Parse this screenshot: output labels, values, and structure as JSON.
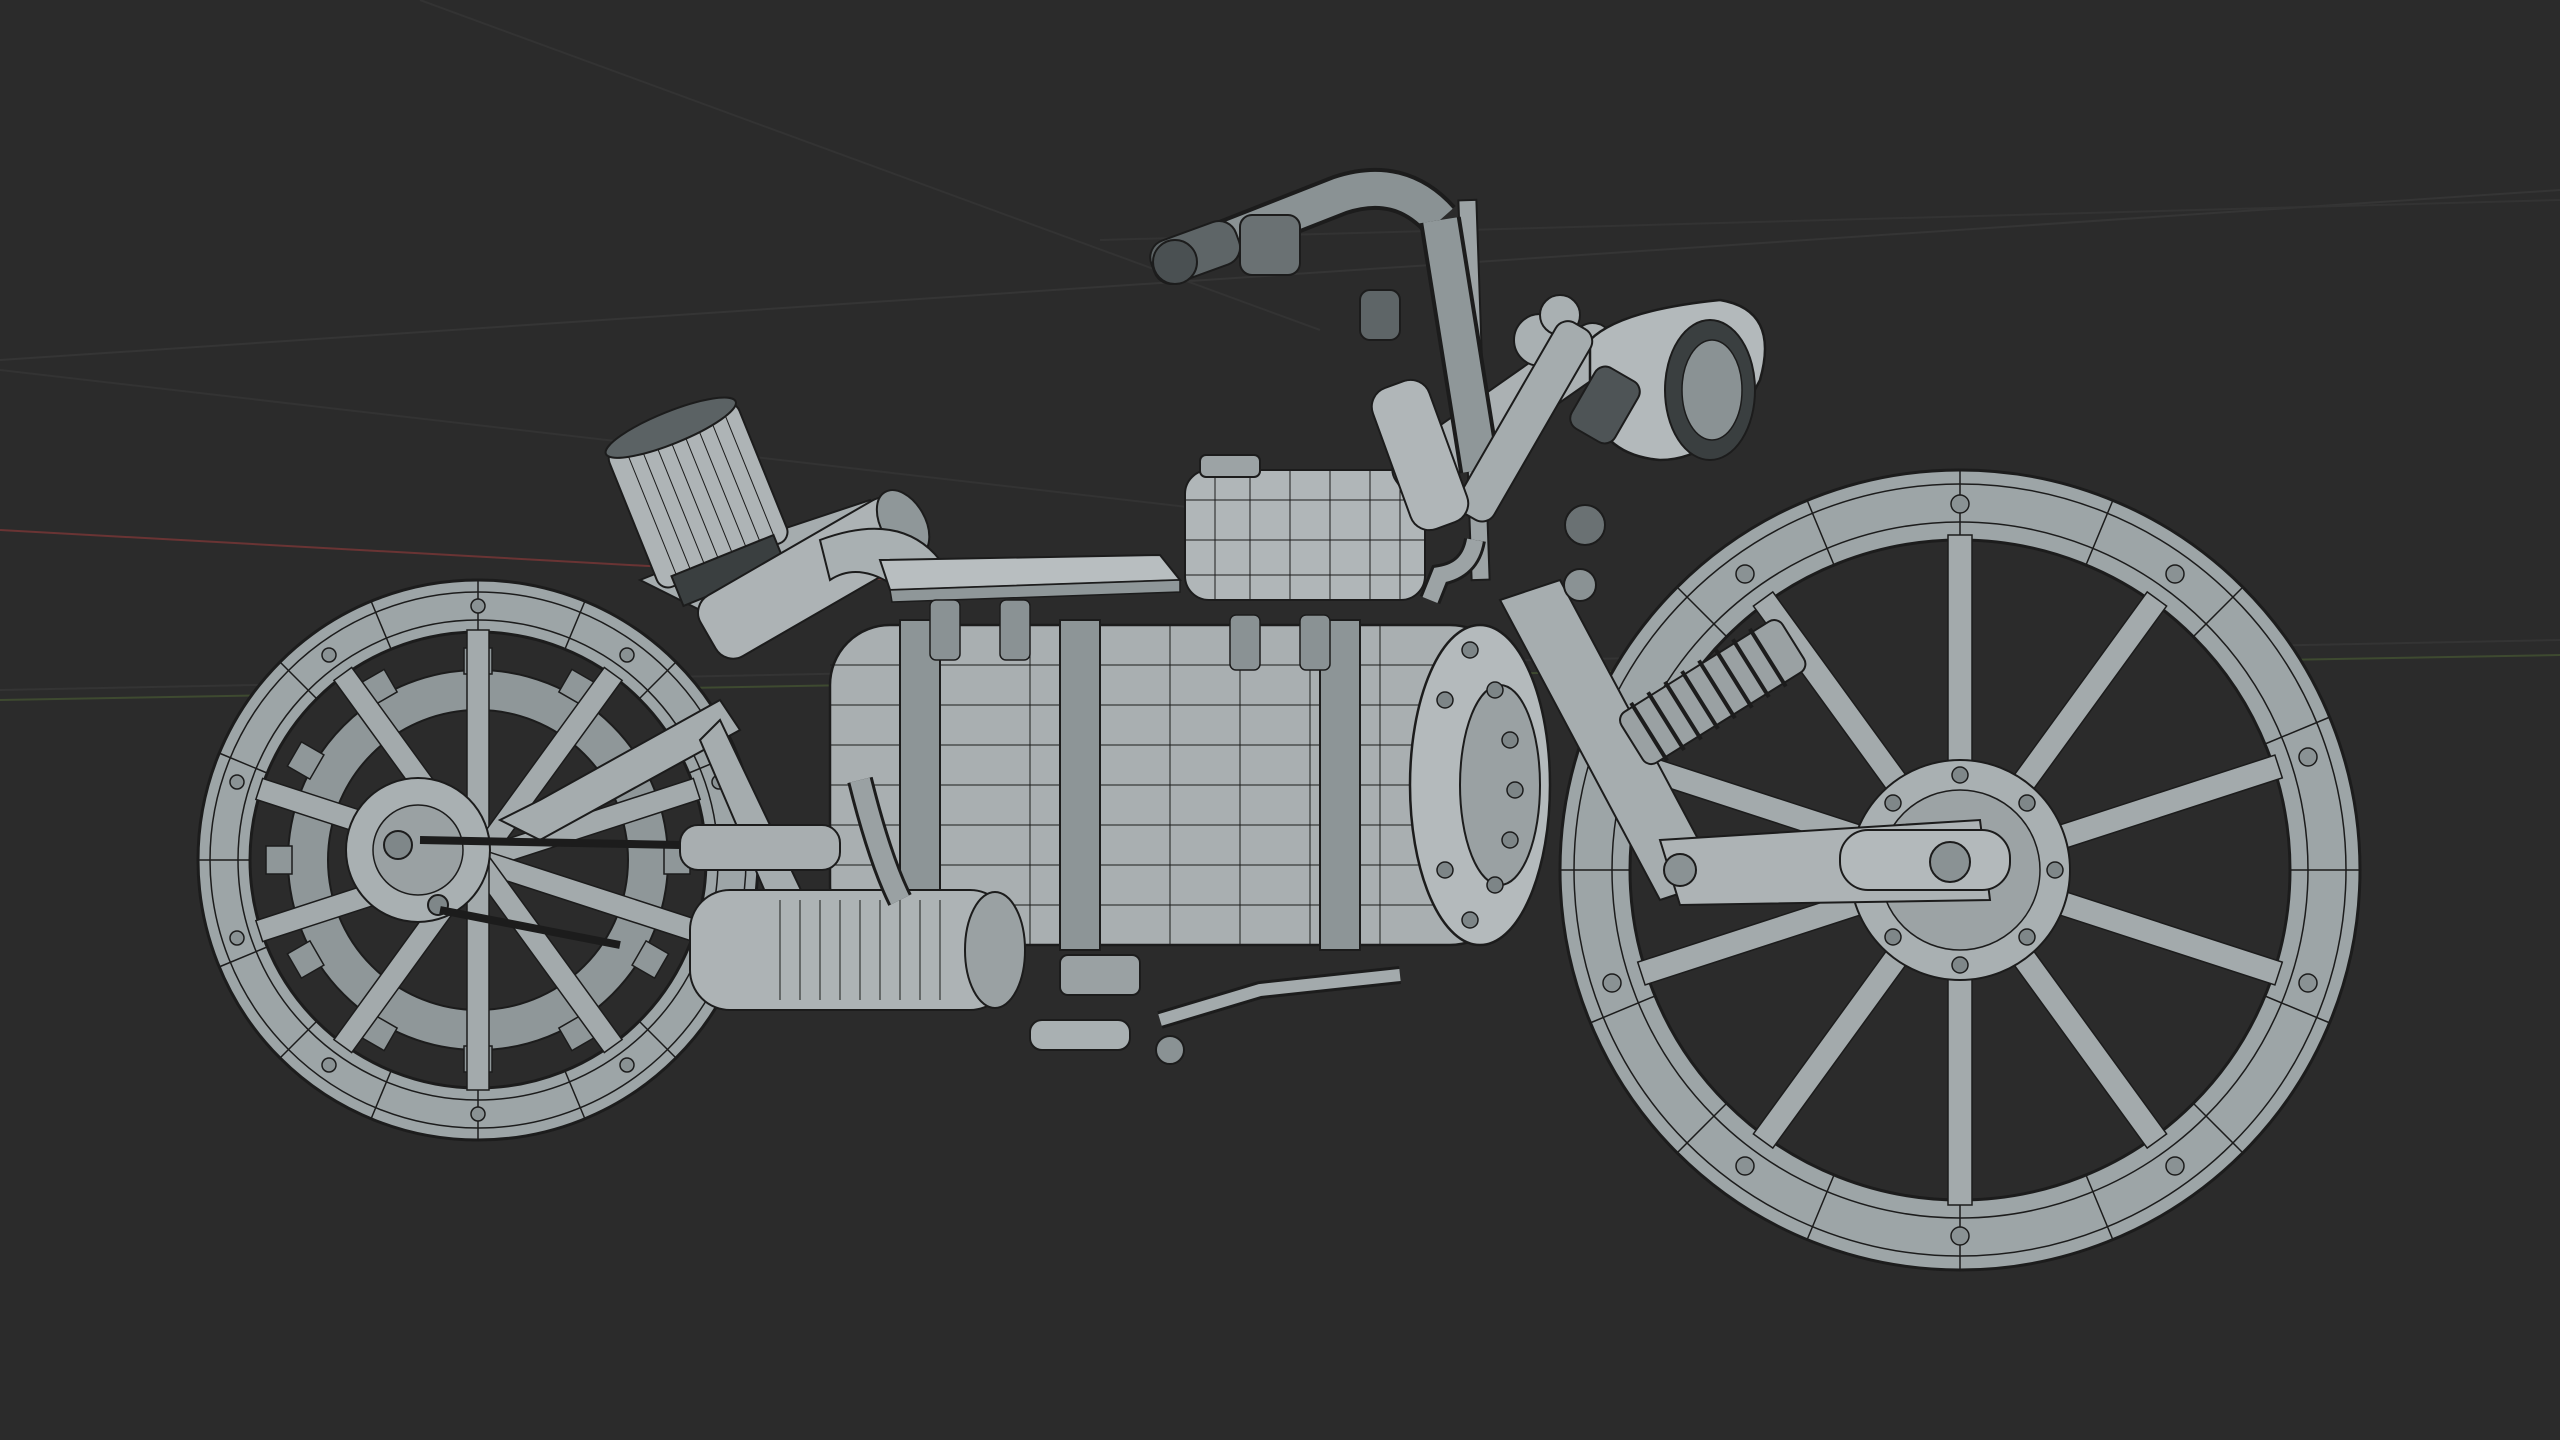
{
  "viewport": {
    "background_color": "#2b2b2b",
    "grid_line_color": "#3a3a3a",
    "x_axis_color": "#7a3a3a",
    "y_axis_color": "#4a6a2a",
    "mesh_color": "#9da5a7",
    "wireframe_color": "#1c1c1c",
    "shading_mode": "solid-wireframe"
  },
  "model": {
    "subject": "steampunk-motorcycle",
    "parts": [
      "rear-wheel",
      "front-wheel",
      "rear-gear",
      "boiler-tank",
      "fuel-tank",
      "headlight",
      "handlebar",
      "front-suspension",
      "air-filter",
      "exhaust-cylinder",
      "footpegs",
      "chain"
    ]
  }
}
